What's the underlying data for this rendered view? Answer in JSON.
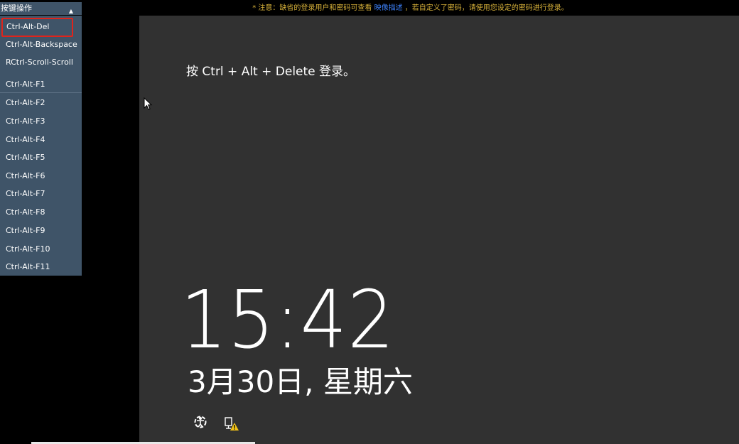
{
  "toolbar": {
    "dropdown_label": "按键操作",
    "notice_prefix": "* 注意：缺省的登录用户和密码可查看",
    "notice_link": "映像描述",
    "notice_suffix": "，若自定义了密码，请使用您设定的密码进行登录。"
  },
  "menu": {
    "items": [
      {
        "label": "Ctrl-Alt-Del"
      },
      {
        "label": "Ctrl-Alt-Backspace"
      },
      {
        "label": "RCtrl-Scroll-Scroll"
      },
      {
        "label": "Ctrl-Alt-F1"
      },
      {
        "label": "Ctrl-Alt-F2"
      },
      {
        "label": "Ctrl-Alt-F3"
      },
      {
        "label": "Ctrl-Alt-F4"
      },
      {
        "label": "Ctrl-Alt-F5"
      },
      {
        "label": "Ctrl-Alt-F6"
      },
      {
        "label": "Ctrl-Alt-F7"
      },
      {
        "label": "Ctrl-Alt-F8"
      },
      {
        "label": "Ctrl-Alt-F9"
      },
      {
        "label": "Ctrl-Alt-F10"
      },
      {
        "label": "Ctrl-Alt-F11"
      }
    ],
    "selected_index": 0
  },
  "lockscreen": {
    "prompt": "按 Ctrl + Alt + Delete 登录。",
    "time": "15:42",
    "date": "3月30日, 星期六"
  },
  "icons": {
    "ease_of_access": "ease-of-access-icon",
    "network_warning": "network-warning-icon",
    "dropdown_caret": "caret-up-icon",
    "cursor": "mouse-pointer-icon"
  },
  "colors": {
    "menu_bg": "#3f5468",
    "notice_text": "#d8b23a",
    "link": "#3c7ff5",
    "selected_border": "#e0241b",
    "screen_bg": "#313131"
  }
}
